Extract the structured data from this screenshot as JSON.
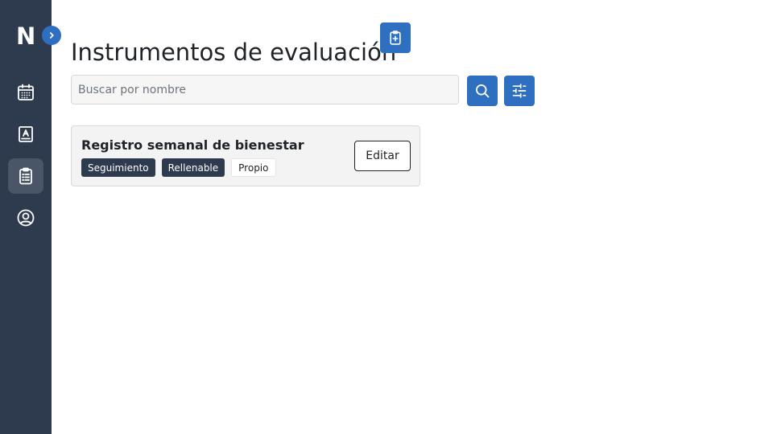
{
  "sidebar": {
    "logo": "N",
    "toggle_icon": "chevron-right-icon",
    "items": [
      {
        "name": "calendar",
        "icon": "calendar-icon"
      },
      {
        "name": "contacts",
        "icon": "contact-book-icon"
      },
      {
        "name": "instruments",
        "icon": "clipboard-list-icon",
        "active": true
      },
      {
        "name": "profile",
        "icon": "user-circle-icon"
      }
    ]
  },
  "header": {
    "title": "Instrumentos de evaluación",
    "add_icon": "clipboard-plus-icon"
  },
  "search": {
    "placeholder": "Buscar por nombre",
    "value": "",
    "search_icon": "search-icon",
    "filter_icon": "sliders-icon"
  },
  "instruments": [
    {
      "title": "Registro semanal de bienestar",
      "tags": [
        "Seguimiento",
        "Rellenable",
        "Propio"
      ],
      "edit_label": "Editar"
    }
  ],
  "colors": {
    "sidebar_bg": "#2e3b4e",
    "accent": "#2e6fbf",
    "active_nav": "#4a5668",
    "card_bg": "#f3f3f3"
  }
}
